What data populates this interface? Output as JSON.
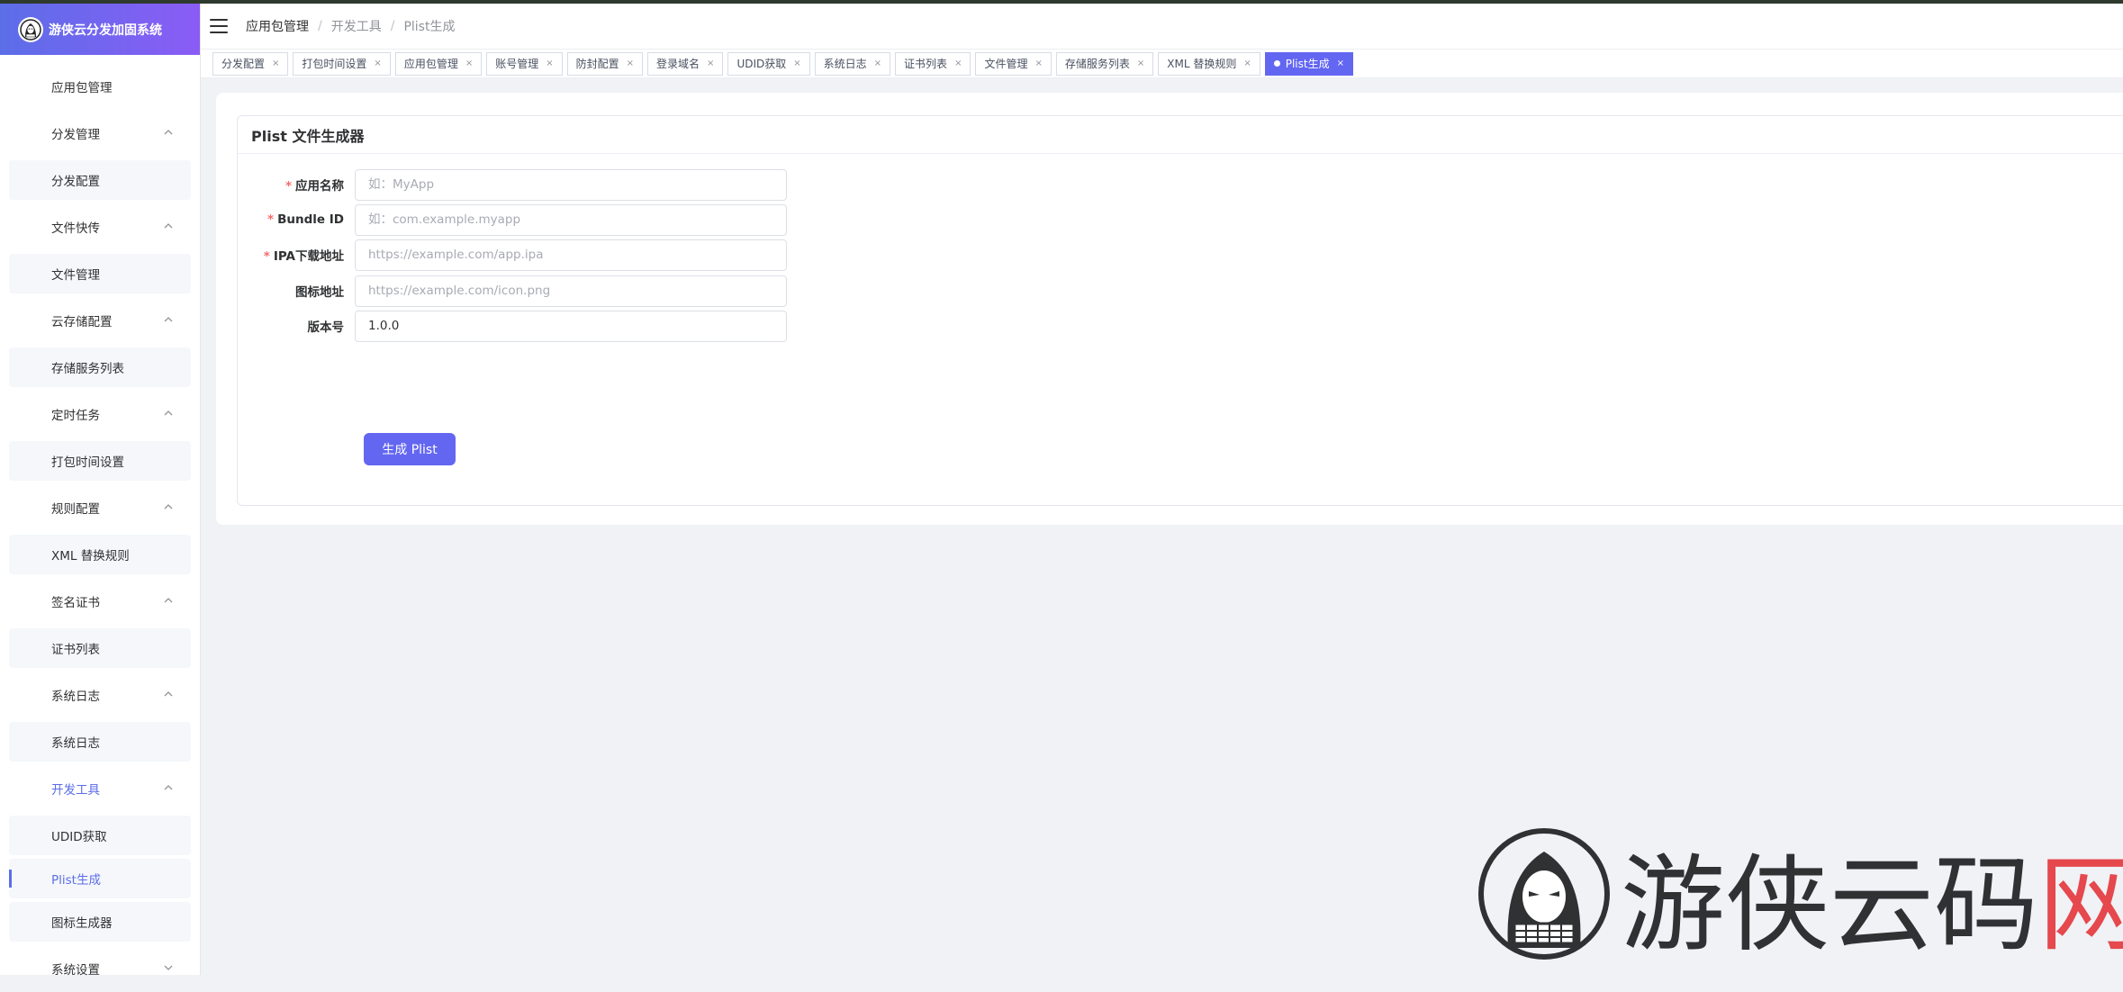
{
  "app": {
    "title": "游侠云分发加固系统"
  },
  "sidebar": {
    "items": [
      {
        "label": "应用包管理",
        "type": "single"
      },
      {
        "label": "分发管理",
        "type": "group",
        "chevron": "up"
      },
      {
        "label": "分发配置",
        "type": "sub"
      },
      {
        "label": "文件快传",
        "type": "group",
        "chevron": "up"
      },
      {
        "label": "文件管理",
        "type": "sub"
      },
      {
        "label": "云存储配置",
        "type": "group",
        "chevron": "up"
      },
      {
        "label": "存储服务列表",
        "type": "sub"
      },
      {
        "label": "定时任务",
        "type": "group",
        "chevron": "up"
      },
      {
        "label": "打包时间设置",
        "type": "sub"
      },
      {
        "label": "规则配置",
        "type": "group",
        "chevron": "up"
      },
      {
        "label": "XML 替换规则",
        "type": "sub"
      },
      {
        "label": "签名证书",
        "type": "group",
        "chevron": "up"
      },
      {
        "label": "证书列表",
        "type": "sub"
      },
      {
        "label": "系统日志",
        "type": "group",
        "chevron": "up"
      },
      {
        "label": "系统日志",
        "type": "sub"
      },
      {
        "label": "开发工具",
        "type": "group",
        "chevron": "up",
        "active": true
      },
      {
        "label": "UDID获取",
        "type": "sub"
      },
      {
        "label": "Plist生成",
        "type": "sub",
        "active": true
      },
      {
        "label": "图标生成器",
        "type": "sub"
      },
      {
        "label": "系统设置",
        "type": "group",
        "chevron": "down"
      }
    ]
  },
  "header": {
    "breadcrumb": [
      "应用包管理",
      "开发工具",
      "Plist生成"
    ]
  },
  "tabs": [
    {
      "label": "分发配置"
    },
    {
      "label": "打包时间设置"
    },
    {
      "label": "应用包管理"
    },
    {
      "label": "账号管理"
    },
    {
      "label": "防封配置"
    },
    {
      "label": "登录域名"
    },
    {
      "label": "UDID获取"
    },
    {
      "label": "系统日志"
    },
    {
      "label": "证书列表"
    },
    {
      "label": "文件管理"
    },
    {
      "label": "存储服务列表"
    },
    {
      "label": "XML 替换规则"
    },
    {
      "label": "Plist生成",
      "active": true
    }
  ],
  "form": {
    "title": "Plist 文件生成器",
    "fields": [
      {
        "label": "应用名称",
        "required": true,
        "value": "",
        "placeholder": "如：MyApp"
      },
      {
        "label": "Bundle ID",
        "required": true,
        "value": "",
        "placeholder": "如：com.example.myapp"
      },
      {
        "label": "IPA下载地址",
        "required": true,
        "value": "",
        "placeholder": "https://example.com/app.ipa"
      },
      {
        "label": "图标地址",
        "required": false,
        "value": "",
        "placeholder": "https://example.com/icon.png"
      },
      {
        "label": "版本号",
        "required": false,
        "value": "1.0.0",
        "placeholder": ""
      }
    ],
    "submit_label": "生成 Plist"
  },
  "watermark": {
    "text_main": "游侠云码",
    "text_accent": "网"
  },
  "colors": {
    "accent": "#6366f1",
    "brand_gradient_start": "#5b6ee8",
    "brand_gradient_end": "#8b5cf6",
    "required": "#f56c6c",
    "watermark_accent": "#e5484d"
  }
}
